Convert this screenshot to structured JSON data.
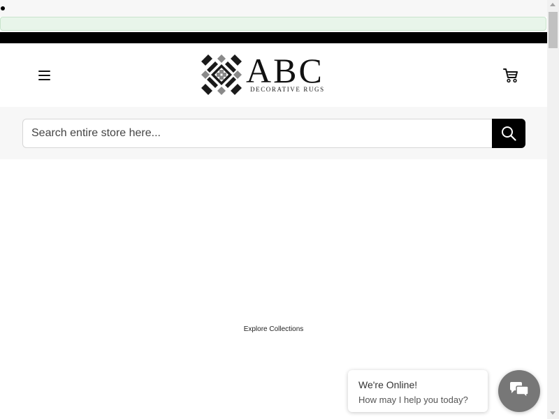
{
  "header": {
    "logo_text": "ABC",
    "logo_subtitle": "DECORATIVE RUGS",
    "menu_icon": "hamburger-menu-icon",
    "cart_icon": "shopping-cart-icon"
  },
  "search": {
    "placeholder": "Search entire store here...",
    "button_icon": "search-icon"
  },
  "main": {
    "explore_label": "Explore Collections"
  },
  "chat": {
    "title": "We're Online!",
    "subtitle": "How may I help you today?",
    "icon": "chat-bubbles-icon"
  },
  "colors": {
    "notice_bar_bg": "#e8f5ea",
    "top_bar": "#000000",
    "search_band_bg": "#f7f7f7",
    "search_button": "#000000",
    "chat_circle": "#777777"
  }
}
